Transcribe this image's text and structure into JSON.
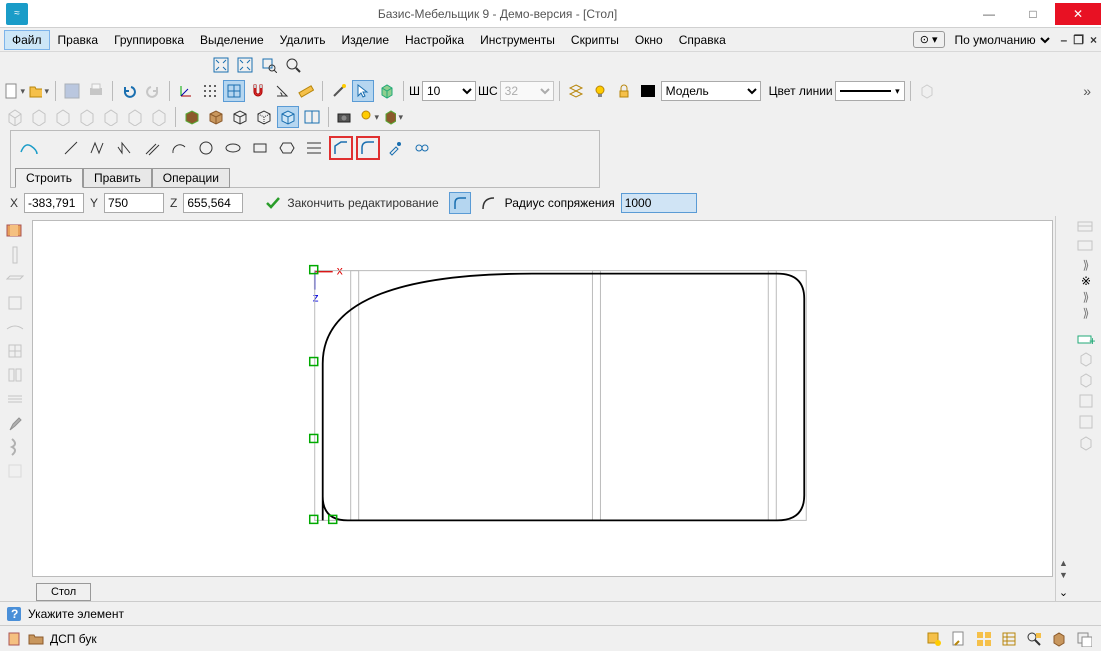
{
  "title": "Базис-Мебельщик 9 - Демо-версия - [Стол]",
  "menu": {
    "file": "Файл",
    "edit": "Правка",
    "group": "Группировка",
    "select": "Выделение",
    "delete": "Удалить",
    "product": "Изделие",
    "settings": "Настройка",
    "tools": "Инструменты",
    "scripts": "Скрипты",
    "window": "Окно",
    "help": "Справка",
    "default_combo": "По умолчанию"
  },
  "toolbar": {
    "w_label": "Ш",
    "w_value": "10",
    "ws_label": "ШС",
    "ws_value": "32",
    "model_label": "Модель",
    "line_color": "Цвет линии"
  },
  "shape_tabs": {
    "build": "Строить",
    "edit": "Править",
    "ops": "Операции"
  },
  "coords": {
    "x_label": "X",
    "x_value": "-383,791",
    "y_label": "Y",
    "y_value": "750",
    "z_label": "Z",
    "z_value": "655,564",
    "finish": "Закончить редактирование",
    "radius_label": "Радиус сопряжения",
    "radius_value": "1000"
  },
  "doc_tab": "Стол",
  "status": {
    "hint": "Укажите элемент",
    "material": "ДСП бук"
  }
}
